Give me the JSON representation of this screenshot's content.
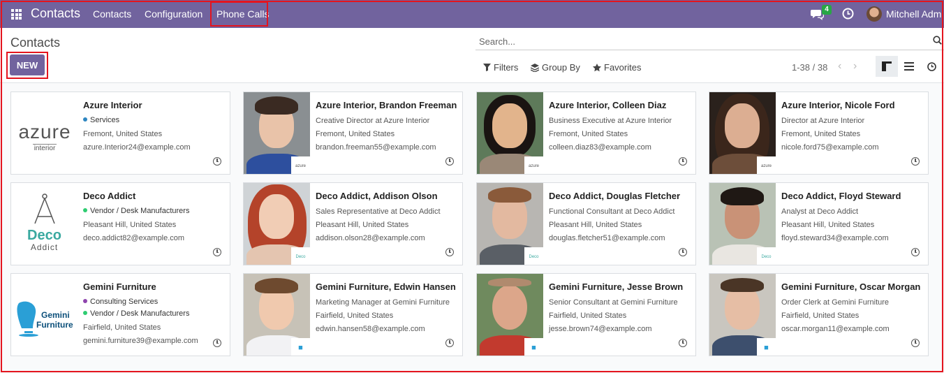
{
  "navbar": {
    "app_title": "Contacts",
    "menu": [
      "Contacts",
      "Configuration",
      "Phone Calls"
    ],
    "messages_count": "4",
    "user_name": "Mitchell Adm"
  },
  "control_panel": {
    "breadcrumb": "Contacts",
    "new_label": "NEW",
    "search_placeholder": "Search...",
    "filters_label": "Filters",
    "group_by_label": "Group By",
    "favorites_label": "Favorites",
    "pager": "1-38 / 38"
  },
  "colors": {
    "brand": "#71639e",
    "highlight": "#e4141e",
    "tag_services": "#2e86c1",
    "tag_vendor": "#2ecc71",
    "tag_consulting": "#8e44ad"
  },
  "cards": [
    {
      "name": "Azure Interior",
      "tags": [
        {
          "label": "Services",
          "color": "#2e86c1"
        }
      ],
      "lines": [
        "Fremont, United States",
        "azure.Interior24@example.com"
      ],
      "image": "azure-logo"
    },
    {
      "name": "Azure Interior, Brandon Freeman",
      "tags": [],
      "lines": [
        "Creative Director at Azure Interior",
        "Fremont, United States",
        "brandon.freeman55@example.com"
      ],
      "image": "portrait"
    },
    {
      "name": "Azure Interior, Colleen Diaz",
      "tags": [],
      "lines": [
        "Business Executive at Azure Interior",
        "Fremont, United States",
        "colleen.diaz83@example.com"
      ],
      "image": "portrait"
    },
    {
      "name": "Azure Interior, Nicole Ford",
      "tags": [],
      "lines": [
        "Director at Azure Interior",
        "Fremont, United States",
        "nicole.ford75@example.com"
      ],
      "image": "portrait"
    },
    {
      "name": "Deco Addict",
      "tags": [
        {
          "label": "Vendor / Desk Manufacturers",
          "color": "#2ecc71"
        }
      ],
      "lines": [
        "Pleasant Hill, United States",
        "deco.addict82@example.com"
      ],
      "image": "deco-logo"
    },
    {
      "name": "Deco Addict, Addison Olson",
      "tags": [],
      "lines": [
        "Sales Representative at Deco Addict",
        "Pleasant Hill, United States",
        "addison.olson28@example.com"
      ],
      "image": "portrait"
    },
    {
      "name": "Deco Addict, Douglas Fletcher",
      "tags": [],
      "lines": [
        "Functional Consultant at Deco Addict",
        "Pleasant Hill, United States",
        "douglas.fletcher51@example.com"
      ],
      "image": "portrait"
    },
    {
      "name": "Deco Addict, Floyd Steward",
      "tags": [],
      "lines": [
        "Analyst at Deco Addict",
        "Pleasant Hill, United States",
        "floyd.steward34@example.com"
      ],
      "image": "portrait"
    },
    {
      "name": "Gemini Furniture",
      "tags": [
        {
          "label": "Consulting Services",
          "color": "#8e44ad"
        },
        {
          "label": "Vendor / Desk Manufacturers",
          "color": "#2ecc71"
        }
      ],
      "lines": [
        "Fairfield, United States",
        "gemini.furniture39@example.com"
      ],
      "image": "gemini-logo"
    },
    {
      "name": "Gemini Furniture, Edwin Hansen",
      "tags": [],
      "lines": [
        "Marketing Manager at Gemini Furniture",
        "Fairfield, United States",
        "edwin.hansen58@example.com"
      ],
      "image": "portrait"
    },
    {
      "name": "Gemini Furniture, Jesse Brown",
      "tags": [],
      "lines": [
        "Senior Consultant at Gemini Furniture",
        "Fairfield, United States",
        "jesse.brown74@example.com"
      ],
      "image": "portrait"
    },
    {
      "name": "Gemini Furniture, Oscar Morgan",
      "tags": [],
      "lines": [
        "Order Clerk at Gemini Furniture",
        "Fairfield, United States",
        "oscar.morgan11@example.com"
      ],
      "image": "portrait"
    }
  ],
  "logos": {
    "azure_word": "azure",
    "azure_sub": "interior",
    "deco_word": "Deco",
    "deco_sub": "Addict",
    "gemini_word": "Gemini",
    "gemini_sub": "Furniture"
  }
}
